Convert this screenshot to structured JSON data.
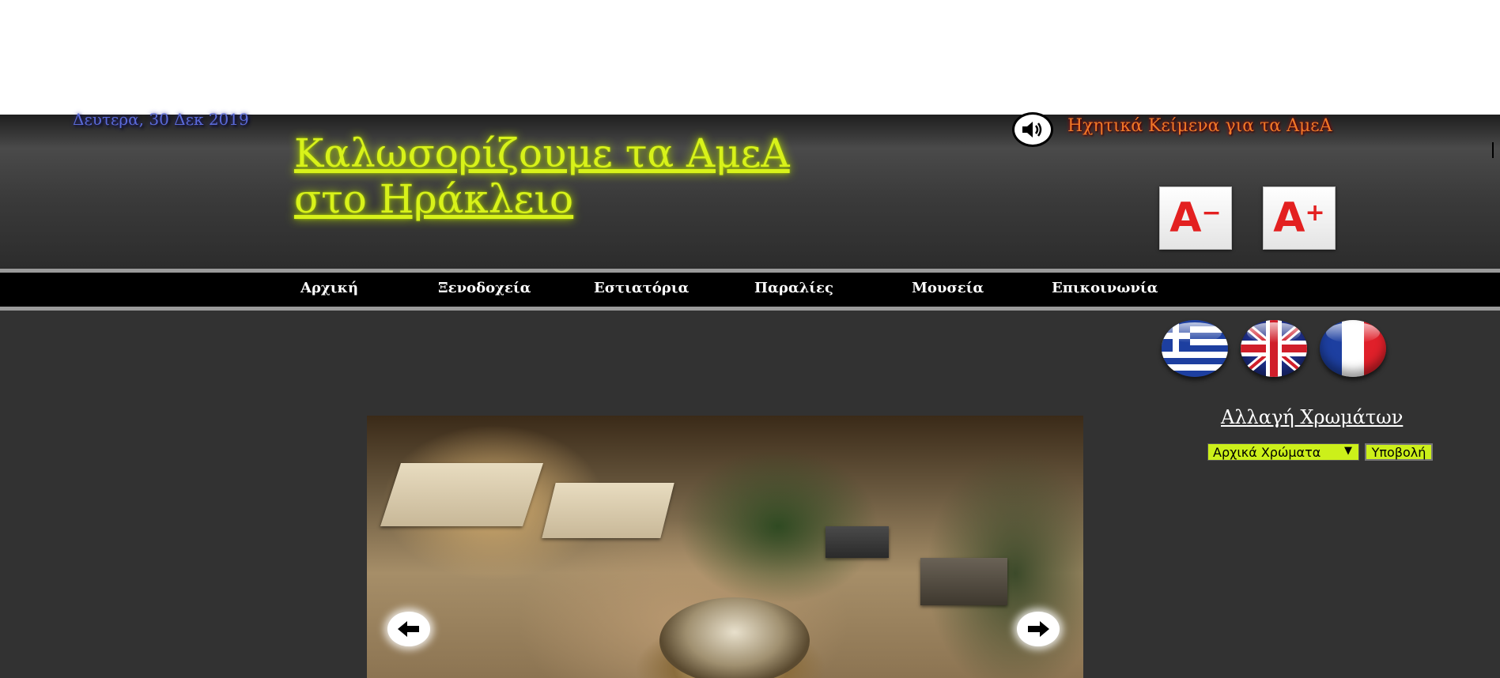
{
  "header": {
    "date": "Δευτερα, 30 Δεκ 2019",
    "title": "Καλωσορίζουμε τα ΑμεΑ στο Ηράκλειο",
    "audio_link": "Ηχητικά Κείμενα για τα ΑμεΑ",
    "font_decrease": {
      "letter": "A",
      "sign": "−"
    },
    "font_increase": {
      "letter": "A",
      "sign": "+"
    }
  },
  "nav": {
    "items": [
      {
        "label": "Αρχική"
      },
      {
        "label": "Ξενοδοχεία"
      },
      {
        "label": "Εστιατόρια"
      },
      {
        "label": "Παραλίες"
      },
      {
        "label": "Μουσεία"
      },
      {
        "label": "Επικοινωνία"
      }
    ]
  },
  "languages": {
    "flags": [
      {
        "icon": "greek-flag-icon"
      },
      {
        "icon": "uk-flag-icon"
      },
      {
        "icon": "french-flag-icon"
      }
    ]
  },
  "colors": {
    "title": "Αλλαγή Χρωμάτων",
    "selected": "Αρχικά Χρώματα",
    "submit_label": "Υποβολή",
    "accent": "#ccf01a",
    "title_color": "#d8f21a",
    "audio_color": "#f07828",
    "date_color": "#5a6ad8"
  },
  "slideshow": {
    "prev_icon": "arrow-left-icon",
    "next_icon": "arrow-right-icon"
  }
}
